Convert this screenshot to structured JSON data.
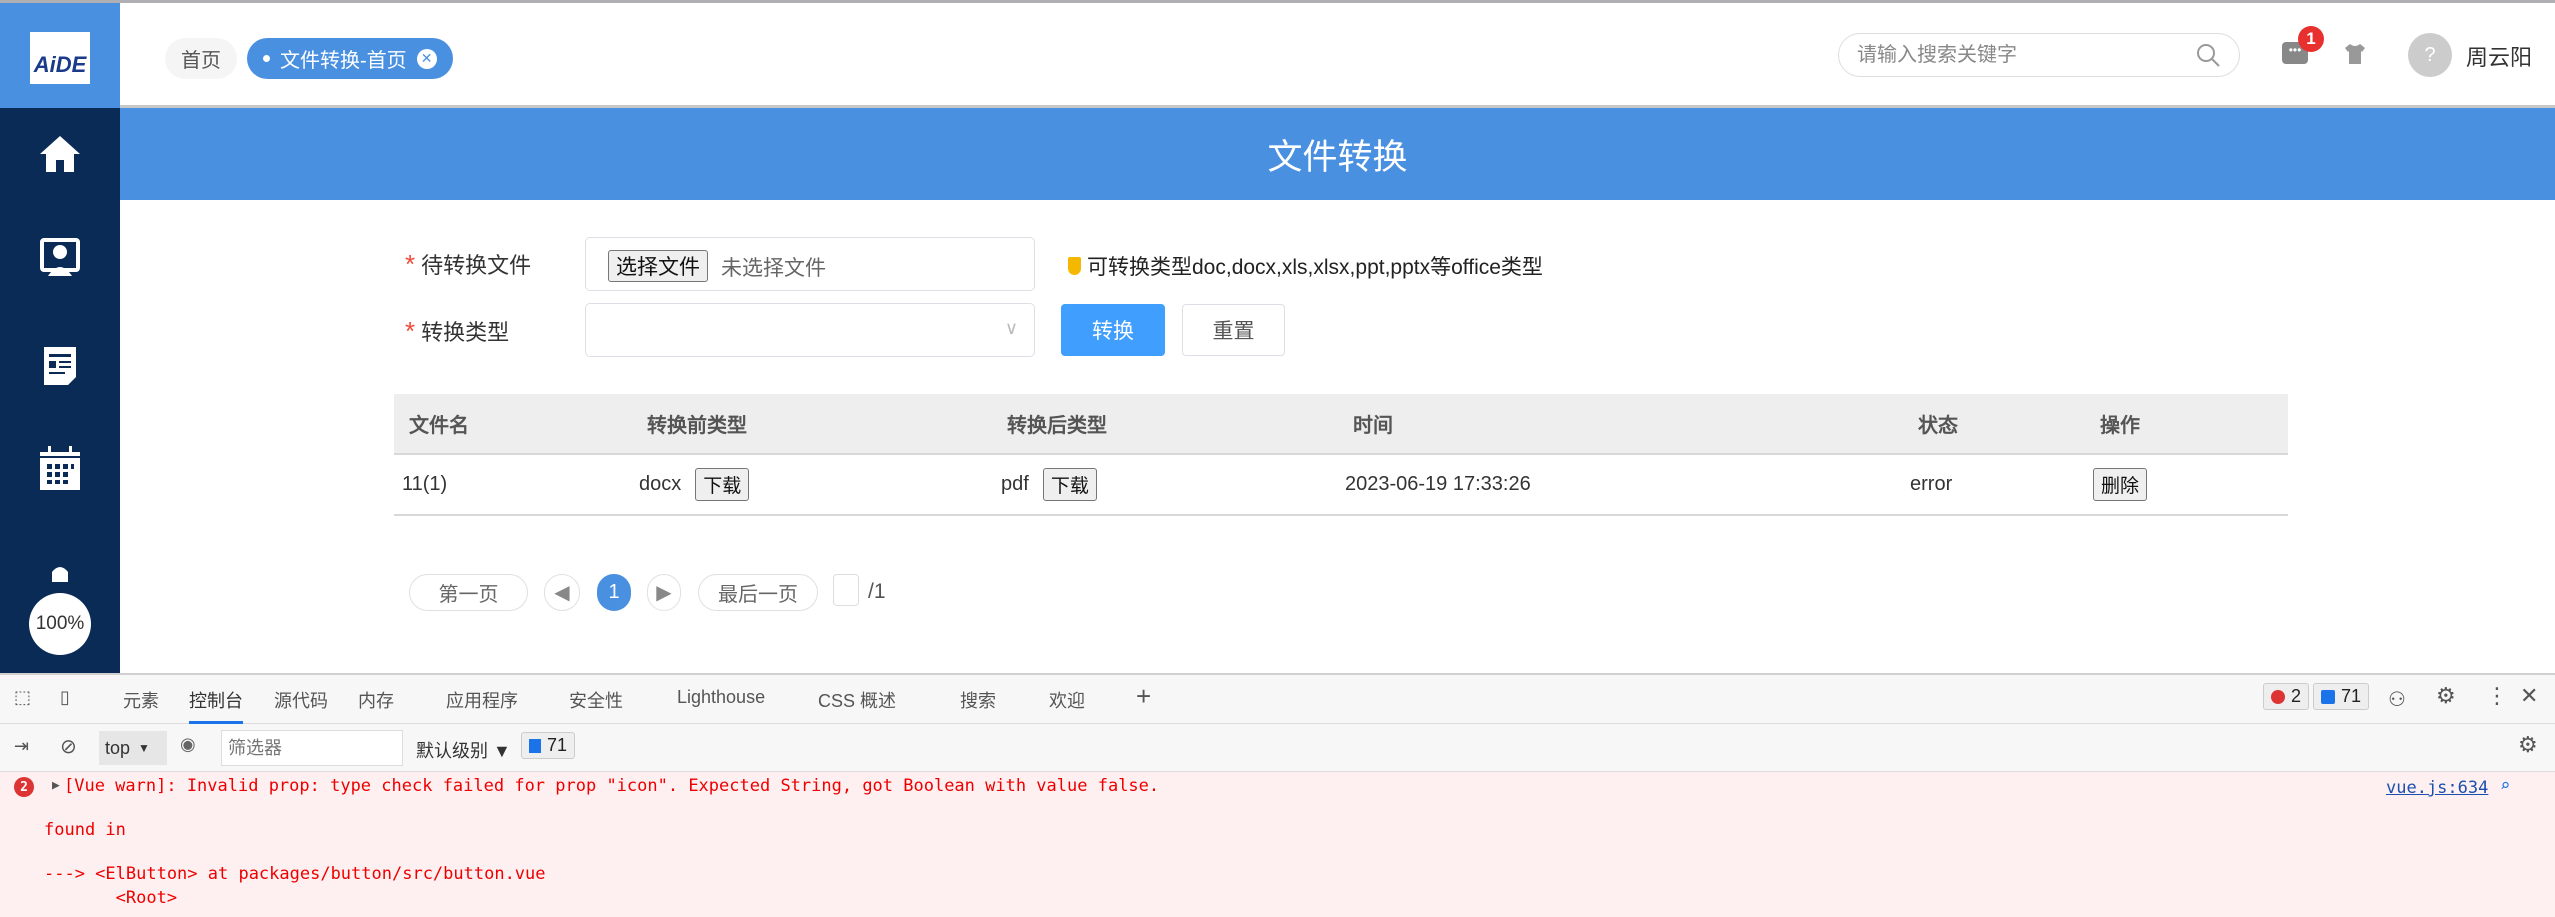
{
  "logo_text": "AiDE",
  "tabs": [
    {
      "label": "首页"
    },
    {
      "label": "文件转换-首页"
    }
  ],
  "header": {
    "search_placeholder": "请输入搜索关键字",
    "notification_count": "1",
    "username": "周云阳",
    "avatar_glyph": "?"
  },
  "sidebar": {
    "zoom_label": "100%"
  },
  "page_title": "文件转换",
  "form": {
    "file_label": "待转换文件",
    "file_button": "选择文件",
    "file_none": "未选择文件",
    "hint": "可转换类型doc,docx,xls,xlsx,ppt,pptx等office类型",
    "type_label": "转换类型",
    "type_value": "",
    "required_mark": "*",
    "convert_button": "转换",
    "reset_button": "重置"
  },
  "table": {
    "headers": [
      "文件名",
      "转换前类型",
      "转换后类型",
      "时间",
      "状态",
      "操作"
    ],
    "rows": [
      {
        "name": "11(1)",
        "before": "docx",
        "after": "pdf",
        "download": "下载",
        "time": "2023-06-19 17:33:26",
        "status": "error",
        "delete": "删除"
      }
    ]
  },
  "pagination": {
    "first": "第一页",
    "current": "1",
    "last": "最后一页",
    "total": "/1",
    "page_input": ""
  },
  "devtools": {
    "tabs": [
      "元素",
      "控制台",
      "源代码",
      "内存",
      "应用程序",
      "安全性",
      "Lighthouse",
      "CSS 概述",
      "搜索",
      "欢迎"
    ],
    "error_count": "2",
    "message_count": "71",
    "context": "top",
    "filter_placeholder": "筛选器",
    "level": "默认级别",
    "console": {
      "badge": "2",
      "line1": "[Vue warn]: Invalid prop: type check failed for prop \"icon\". Expected String, got Boolean with value false.",
      "line2": "found in",
      "line3": "---> <ElButton> at packages/button/src/button.vue",
      "line4": "       <Root>",
      "source": "vue.js:634"
    }
  }
}
